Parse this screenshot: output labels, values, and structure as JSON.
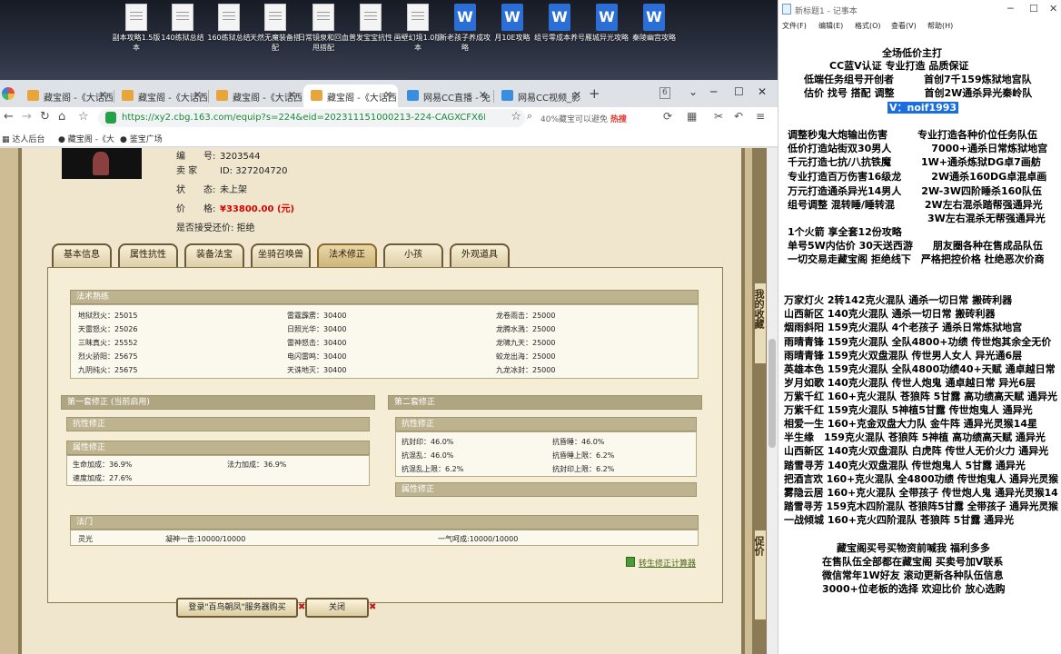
{
  "desktop": {
    "icons": [
      {
        "label": "副本攻略1.5版本",
        "type": "txt"
      },
      {
        "label": "140练狱总结",
        "type": "txt"
      },
      {
        "label": "160练狱总结",
        "type": "txt"
      },
      {
        "label": "天然无魔装备搭配",
        "type": "txt"
      },
      {
        "label": "日常镜泉和回血甩搭配",
        "type": "txt"
      },
      {
        "label": "普发宝宝抗性",
        "type": "txt"
      },
      {
        "label": "画壁幻境1.0版本",
        "type": "txt"
      },
      {
        "label": "新老孩子养成攻略",
        "type": "doc"
      },
      {
        "label": "月10E攻略",
        "type": "doc"
      },
      {
        "label": "组号零成本养号",
        "type": "doc"
      },
      {
        "label": "雁城异光攻略",
        "type": "doc"
      },
      {
        "label": "秦陵幽宫攻略",
        "type": "doc"
      }
    ]
  },
  "browser": {
    "tab_count": "6",
    "tabs": [
      {
        "title": "藏宝阁 -《大话西",
        "color": "#e8a63a"
      },
      {
        "title": "藏宝阁 -《大话西",
        "color": "#e8a63a"
      },
      {
        "title": "藏宝阁 -《大话西",
        "color": "#e8a63a"
      },
      {
        "title": "藏宝阁 -《大话西",
        "color": "#e8a63a"
      },
      {
        "title": "网易CC直播 - 免",
        "color": "#3a8ee0"
      },
      {
        "title": "网易CC视频_影",
        "color": "#3a8ee0"
      }
    ],
    "url": "https://xy2.cbg.163.com/equip?s=224&eid=202311151000213-224-CAGXCFX6KXQ9&o",
    "search_hint": "40%藏宝可以避免",
    "search_hot": "热搜",
    "bookmarks": [
      "达人后台",
      "藏宝阁 -《大",
      "鉴宝广场"
    ]
  },
  "page": {
    "id_value_partial": "3203544",
    "seller_label": "卖 家",
    "id_label": "ID:",
    "seller_id": "327204720",
    "status_label": "状　　态:",
    "status_value": "未上架",
    "price_label": "价　　格:",
    "price_value": "¥33800.00 (元)",
    "bargain_label": "是否接受还价:",
    "bargain_value": "拒绝",
    "tabs": [
      "基本信息",
      "属性抗性",
      "装备法宝",
      "坐骑召唤兽",
      "法术修正",
      "小孩",
      "外观道具"
    ],
    "active_tab": "法术修正",
    "proficiency": {
      "title": "法术熟练",
      "col1": [
        "地狱烈火：25015",
        "天雷怒火：25026",
        "三昧真火：25552",
        "烈火骄阳：25675",
        "九阴纯火：25675"
      ],
      "col2": [
        "雷霆霹雳：30400",
        "日照光华：30400",
        "雷神怒击：30400",
        "电闪雷鸣：30400",
        "天诛地灭：30400"
      ],
      "col3": [
        "龙卷雨击：25000",
        "龙腾水溅：25000",
        "龙啸九天：25000",
        "蛟龙出海：25000",
        "九龙冰封：25000"
      ]
    },
    "set1": {
      "title": "第一套修正 (当前启用)",
      "resist_title": "抗性修正",
      "attr_title": "属性修正",
      "attrs": [
        "生命加成：36.9%",
        "法力加成：36.9%",
        "速度加成：27.6%"
      ]
    },
    "set2": {
      "title": "第二套修正",
      "resist_title": "抗性修正",
      "resists": [
        "抗封印：46.0%",
        "抗昏睡：46.0%",
        "抗混乱：46.0%",
        "抗昏睡上限：6.2%",
        "抗混乱上限：6.2%",
        "抗封印上限：6.2%"
      ],
      "attr_title": "属性修正"
    },
    "fa_men": {
      "title": "法门",
      "items": [
        "灵光",
        "凝神一击:10000/10000",
        "一气呵成:10000/10000"
      ]
    },
    "calc_link": "转生修正计算器",
    "buy_button": "登录\"百鸟朝凤\"服务器购买",
    "close_button": "关闭",
    "side_tab_a": "我的收藏",
    "side_tab_b": "促价"
  },
  "notepad": {
    "title": "新标题1 - 记事本",
    "menu": [
      "文件(F)",
      "编辑(E)",
      "格式(O)",
      "查看(V)",
      "帮助(H)"
    ],
    "lines": [
      "全场低价主打",
      "CC蓝V认证 专业打造 品质保证",
      "低端任务组号开创者　　　首创7千159炼狱地宫队",
      "估价 找号 搭配 调整　　　首创2W通杀异光秦岭队",
      "V：noif1993",
      "调整秒鬼大炮输出伤害　　　专业打造各种价位任务队伍",
      "低价打造站街双30男人　　　　7000+通杀日常炼狱地宫",
      "千元打造七抗/八抗铁魔　　　1W+通杀炼狱DG卓7画舫",
      "专业打造百万伤害16级龙　　　2W通杀160DG卓混卓画",
      "万元打造通杀异光14男人　　2W-3W四阶睡杀160队伍",
      "组号调整 混转睡/睡转混　　　2W左右混杀踏帮强通异光",
      "　　　　　　　　　　　　　　3W左右混杀无帮强通异光",
      "1个火箭 享全套12份攻略",
      "单号5W内估价 30天送西游　　朋友圈各种在售成品队伍",
      "一切交易走藏宝阁 拒绝线下　严格把控价格 杜绝恶次价商",
      "万家灯火 2转142克火混队 通杀一切日常 搬砖利器",
      "山西新区 140克火混队 通杀一切日常 搬砖利器",
      "烟雨斜阳 159克火混队 4个老孩子 通杀日常炼狱地宫",
      "雨晴青锋 159克火混队 全队4800+功绩 传世炮其余全无价",
      "雨晴青锋 159克火双盘混队 传世男人女人 异光通6层",
      "英雄本色 159克火混队 全队4800功绩40+天赋 通卓越日常",
      "岁月如歌 140克火混队 传世人炮鬼 通卓越日常 异光6层",
      "万紫千红 160+克火混队 苍狼阵 5甘露 高功绩高天赋 通异光",
      "万紫千红 159克火混队 5神植5甘露 传世炮鬼人 通异光",
      "相爱一生 160+克金双盘大力队 金牛阵 通异光灵猴14星",
      "半生缘　159克火混队 苍狼阵 5神植 高功绩高天赋 通异光",
      "山西新区 140克火双盘混队 白虎阵 传世人无价火力 通异光",
      "踏雪寻芳 140克火双盘混队 传世炮鬼人 5甘露 通异光",
      "把酒言欢 160+克火混队 全4800功绩 传世炮鬼人 通异光灵猴",
      "雾隐云居 160+克火混队 全带孩子 传世炮人鬼 通异光灵猴14",
      "踏雪寻芳 159克木四阶混队 苍狼阵5甘露 全带孩子 通异光灵猴",
      "一战倾城 160+克火四阶混队 苍狼阵 5甘露 通异光",
      "藏宝阁买号买物资前喊我 福利多多",
      "在售队伍全部都在藏宝阁 买卖号加V联系",
      "微信常年1W好友 滚动更新各种队伍信息",
      "3000+位老板的选择 欢迎比价 放心选购"
    ]
  }
}
